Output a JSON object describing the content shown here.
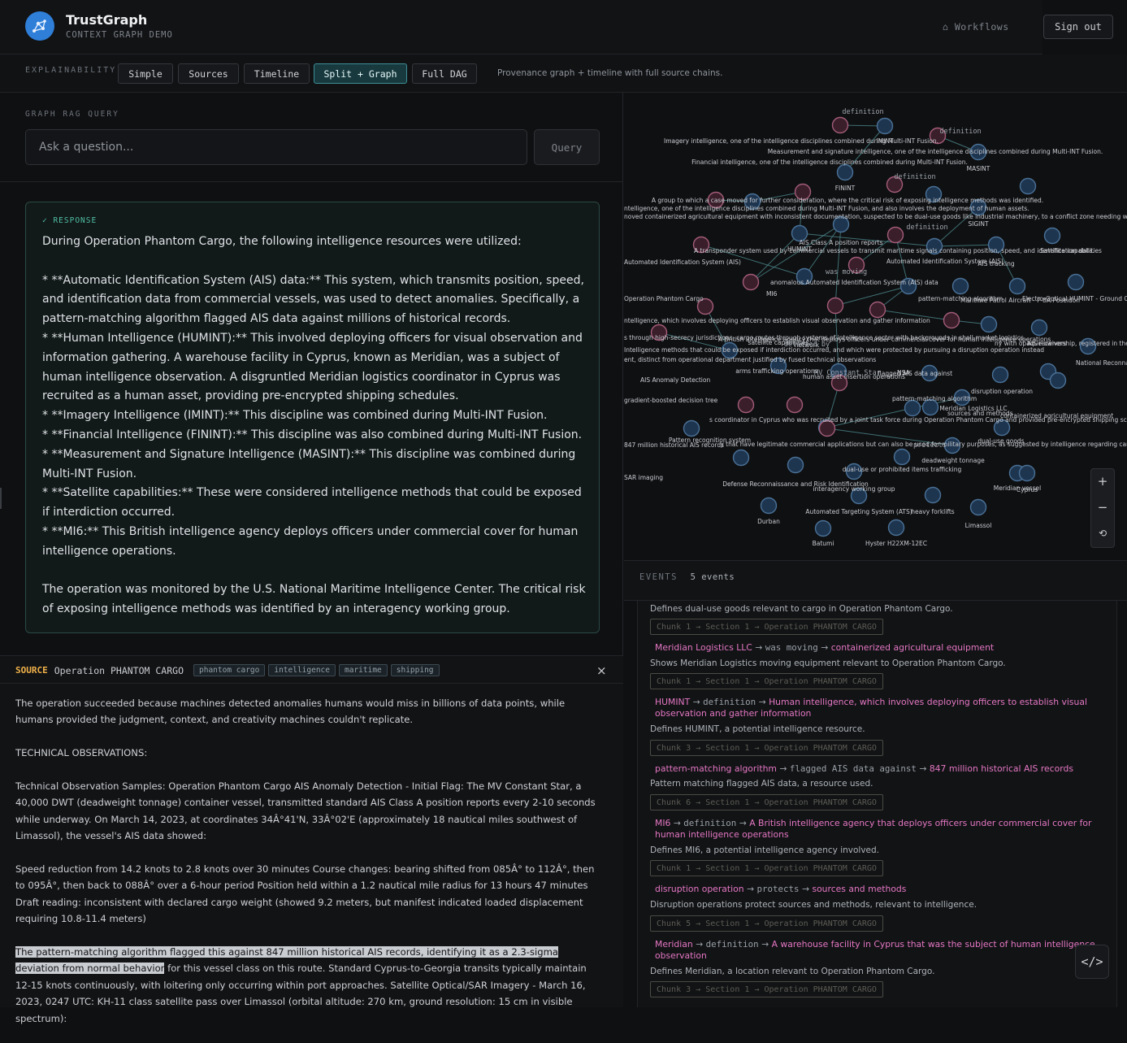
{
  "header": {
    "title": "TrustGraph",
    "subtitle": "CONTEXT GRAPH DEMO",
    "workflows_label": "⌂ Workflows",
    "signout_label": "Sign out"
  },
  "explain": {
    "label": "EXPLAINABILITY",
    "tabs": [
      {
        "label": "Simple"
      },
      {
        "label": "Sources"
      },
      {
        "label": "Timeline"
      },
      {
        "label": "Split + Graph",
        "active": true
      },
      {
        "label": "Full DAG"
      }
    ],
    "description": "Provenance graph + timeline with full source chains."
  },
  "query": {
    "label": "GRAPH RAG QUERY",
    "placeholder": "Ask a question...",
    "button": "Query"
  },
  "response": {
    "label": "✓ RESPONSE",
    "paragraphs": [
      "During Operation Phantom Cargo, the following intelligence resources were utilized:",
      "",
      "*   **Automatic Identification System (AIS) data:** This system, which transmits position, speed, and identification data from commercial vessels, was used to detect anomalies. Specifically, a pattern-matching algorithm flagged AIS data against millions of historical records.",
      "*   **Human Intelligence (HUMINT):** This involved deploying officers for visual observation and information gathering. A warehouse facility in Cyprus, known as Meridian, was a subject of human intelligence observation. A disgruntled Meridian logistics coordinator in Cyprus was recruited as a human asset, providing pre-encrypted shipping schedules.",
      "*   **Imagery Intelligence (IMINT):** This discipline was combined during Multi-INT Fusion.",
      "*   **Financial Intelligence (FININT):** This discipline was also combined during Multi-INT Fusion.",
      "*   **Measurement and Signature Intelligence (MASINT):** This discipline was combined during Multi-INT Fusion.",
      "*   **Satellite capabilities:** These were considered intelligence methods that could be exposed if interdiction occurred.",
      "*   **MI6:** This British intelligence agency deploys officers under commercial cover for human intelligence operations.",
      "",
      "The operation was monitored by the U.S. National Maritime Intelligence Center. The critical risk of exposing intelligence methods was identified by an interagency working group."
    ]
  },
  "source": {
    "tag": "SOURCE",
    "title": "Operation PHANTOM CARGO",
    "chips": [
      "phantom cargo",
      "intelligence",
      "maritime",
      "shipping"
    ],
    "close": "×",
    "p1": "The operation succeeded because machines detected anomalies humans would miss in billions of data points, while humans provided the judgment, context, and creativity machines couldn't replicate.",
    "p2": "TECHNICAL OBSERVATIONS:",
    "p3": "Technical Observation Samples: Operation Phantom Cargo AIS Anomaly Detection - Initial Flag: The MV Constant Star, a 40,000 DWT (deadweight tonnage) container vessel, transmitted standard AIS Class A position reports every 2-10 seconds while underway. On March 14, 2023, at coordinates 34Â°41'N, 33Â°02'E (approximately 18 nautical miles southwest of Limassol), the vessel's AIS data showed:",
    "p4": "Speed reduction from 14.2 knots to 2.8 knots over 30 minutes Course changes: bearing shifted from 085Â° to 112Â°, then to 095Â°, then back to 088Â° over a 6-hour period Position held within a 1.2 nautical mile radius for 13 hours 47 minutes Draft reading: inconsistent with declared cargo weight (showed 9.2 meters, but manifest indicated loaded displacement requiring 10.8-11.4 meters)",
    "p5_highlight": "The pattern-matching algorithm flagged this against 847 million historical AIS records, identifying it as a 2.3-sigma deviation from normal behavior",
    "p5_rest": " for this vessel class on this route. Standard Cyprus-to-Georgia transits typically maintain 12-15 knots continuously, with loitering only occurring within port approaches. Satellite Optical/SAR Imagery - March 16, 2023, 0247 UTC: KH-11 class satellite pass over Limassol (orbital altitude: 270 km, ground resolution: 15 cm in visible spectrum):"
  },
  "graph": {
    "node_colors": {
      "entity": "#1e3550",
      "definition": "#3a1e2a",
      "entity_stroke": "#4a7196",
      "definition_stroke": "#a25c78"
    },
    "edge_color": "#4f8f93",
    "labels": [
      "definition",
      "Imagery intelligence, one of the intelligence disciplines combined during Multi-INT Fusion.",
      "IMINT",
      "definition",
      "Measurement and signature intelligence, one of the intelligence disciplines combined during Multi-INT Fusion.",
      "MASINT",
      "Financial intelligence, one of the intelligence disciplines combined during Multi-INT Fusion.",
      "FININT",
      "definition",
      "A group to which a case moved for further consideration, where the critical risk of exposing intelligence methods was identified.",
      "ntelligence, one of the intelligence disciplines combined during Multi-INT Fusion, and also involves the deployment of human assets.",
      "noved containerized agricultural equipment with inconsistent documentation, suspected to be dual-use goods like industrial machinery, to a conflict zone needing weapons w",
      "SIGINT",
      "definition",
      "AIS Class A position reports",
      "HUMINT",
      "A transponder system used by commercial vessels to transmit maritime signals containing position, speed, and identification data.",
      "Satellite capabilities",
      "AIS tracking",
      "Automated Identification System (AIS)",
      "anomalous Automated Identification System (AIS) data",
      "Operation Phantom Cargo",
      "MI6",
      "pattern-matching algorithm",
      "Maritime Patrol Aircraft - P-8A Poseidon",
      "Electro-Optical HUMINT - Ground Observ",
      "ntelligence, which involves deploying officers to establish visual observation and gather information",
      "s through high-secrecy jurisdictions, cargo routes through systems of intelligence sector with backgrounds in shell-market logistics.",
      "A British intelligence agency that deploys officers under commercial cover for human intelligence operations",
      "Intelligence methods that could be exposed if interdiction occurred, and which were protected by pursuing a disruption operation instead",
      "ent, distinct from operational department justified by fused technical observations",
      "ny with opaque ownership, registered in the UAE but operated by a network spanning six countries, which was involved in moving containerized agricultural equipment in irre",
      "National Reconnaissance Office",
      "AIS receivers",
      "satellite capabilities",
      "network",
      "AIS Anomaly Detection",
      "arms trafficking operations",
      "human asset insertion operations",
      "disruption operation",
      "Meridian Logistics LLC",
      "NSA",
      "pattern-matching algorithm",
      "gradient-boosted decision tree",
      "s coordinator in Cyprus who was recruited by a joint task force during Operation Phantom Cargo and provided pre-encrypted shipping schedules, leading to the operation's col",
      "sources and methods",
      "containerized agricultural equipment",
      "847 million historical AIS records",
      "Pattern recognition system",
      "y that have legitimate commercial applications but can also be used for military purposes, as suggested by intelligence regarding cargo manifests during Operation Phantom Carg",
      "SAR imaging",
      "Defense Reconnaissance and Risk Identification",
      "interagency working group",
      "dual-use or prohibited items trafficking",
      "deadweight tonnage",
      "dual-use goods",
      "Meridian vessel",
      "Durban",
      "Batumi",
      "Hyster H22XM-12EC",
      "Automated Targeting System (ATS)",
      "heavy forklifts",
      "Limassol",
      "Cyprus",
      "MV Constant Star",
      "was moving",
      "detected by",
      "protects",
      "flagged AIS data against",
      "Asset"
    ]
  },
  "zoom": {
    "plus": "+",
    "minus": "−",
    "reset": "⟲"
  },
  "events": {
    "label": "EVENTS",
    "count": "5 events",
    "items": [
      {
        "desc": "Defines dual-use goods relevant to cargo in Operation Phantom Cargo.",
        "chunk": "Chunk 1 → Section 1 → Operation PHANTOM CARGO"
      },
      {
        "subject": "Meridian Logistics LLC",
        "predicate": "was moving",
        "object": "containerized agricultural equipment",
        "desc": "Shows Meridian Logistics moving equipment relevant to Operation Phantom Cargo.",
        "chunk": "Chunk 1 → Section 1 → Operation PHANTOM CARGO"
      },
      {
        "subject": "HUMINT",
        "predicate": "definition",
        "object": "Human intelligence, which involves deploying officers to establish visual observation and gather information",
        "desc": "Defines HUMINT, a potential intelligence resource.",
        "chunk": "Chunk 3 → Section 1 → Operation PHANTOM CARGO"
      },
      {
        "subject": "pattern-matching algorithm",
        "predicate": "flagged AIS data against",
        "object": "847 million historical AIS records",
        "desc": "Pattern matching flagged AIS data, a resource used.",
        "chunk": "Chunk 6 → Section 1 → Operation PHANTOM CARGO"
      },
      {
        "subject": "MI6",
        "predicate": "definition",
        "object": "A British intelligence agency that deploys officers under commercial cover for human intelligence operations",
        "desc": "Defines MI6, a potential intelligence agency involved.",
        "chunk": "Chunk 1 → Section 1 → Operation PHANTOM CARGO"
      },
      {
        "subject": "disruption operation",
        "predicate": "protects",
        "object": "sources and methods",
        "desc": "Disruption operations protect sources and methods, relevant to intelligence.",
        "chunk": "Chunk 5 → Section 1 → Operation PHANTOM CARGO"
      },
      {
        "subject": "Meridian",
        "predicate": "definition",
        "object": "A warehouse facility in Cyprus that was the subject of human intelligence observation",
        "desc": "Defines Meridian, a location relevant to Operation Phantom Cargo.",
        "chunk": "Chunk 3 → Section 1 → Operation PHANTOM CARGO"
      }
    ]
  },
  "code_button": "</>"
}
